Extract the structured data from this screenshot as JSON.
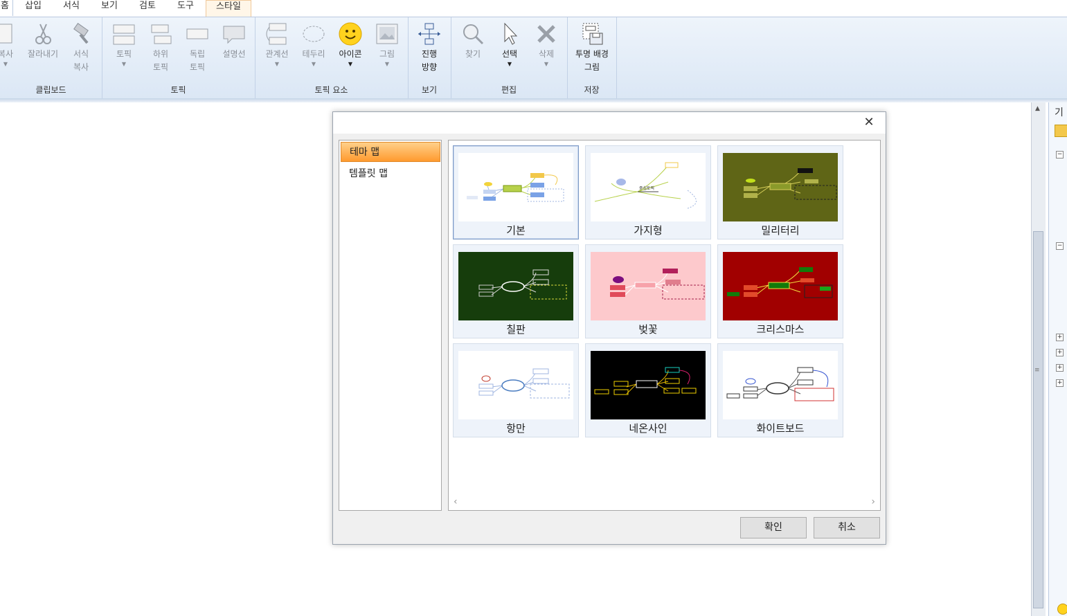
{
  "tabs": [
    "홈",
    "삽입",
    "서식",
    "보기",
    "검토",
    "도구",
    "스타일"
  ],
  "ribbon": {
    "clipboard": {
      "label": "클립보드",
      "copy": "복사",
      "cut": "잘라내기",
      "format_copy_1": "서식",
      "format_copy_2": "복사"
    },
    "topic": {
      "label": "토픽",
      "topic": "토픽",
      "sub_1": "하위",
      "sub_2": "토픽",
      "float_1": "독립",
      "float_2": "토픽",
      "callout": "설명선"
    },
    "topic_elements": {
      "label": "토픽 요소",
      "relation": "관계선",
      "boundary": "테두리",
      "icon": "아이콘",
      "image": "그림"
    },
    "view": {
      "label": "보기",
      "direction_1": "진행",
      "direction_2": "방향"
    },
    "edit": {
      "label": "편집",
      "find": "찾기",
      "select": "선택",
      "delete": "삭제"
    },
    "save": {
      "label": "저장",
      "transparent_1": "투명 배경",
      "transparent_2": "그림"
    }
  },
  "side_panel": {
    "title": "기"
  },
  "dialog": {
    "categories": [
      "테마 맵",
      "템플릿 맵"
    ],
    "selected_category": "테마 맵",
    "themes": [
      {
        "name": "기본",
        "bg": "#ffffff",
        "selected": true
      },
      {
        "name": "가지형",
        "bg": "#ffffff"
      },
      {
        "name": "밀리터리",
        "bg": "#5f6516"
      },
      {
        "name": "칠판",
        "bg": "#163d0c"
      },
      {
        "name": "벚꽃",
        "bg": "#fdc9cc"
      },
      {
        "name": "크리스마스",
        "bg": "#a10000"
      },
      {
        "name": "항만",
        "bg": "#ffffff"
      },
      {
        "name": "네온사인",
        "bg": "#000000"
      },
      {
        "name": "화이트보드",
        "bg": "#ffffff"
      }
    ],
    "ok": "확인",
    "cancel": "취소"
  },
  "colors": {
    "ribbon_bg": "#dbe7f5",
    "selection": "#ff9a2e",
    "dialog_bg": "#f0f0f0"
  }
}
